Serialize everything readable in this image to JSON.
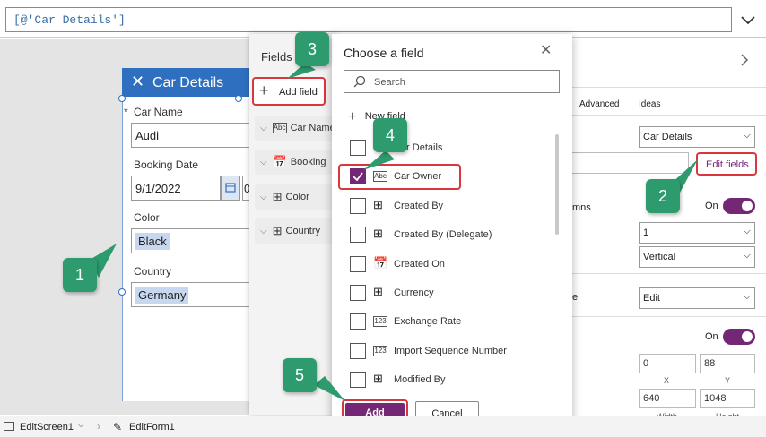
{
  "formula": {
    "value": "[@'Car Details']"
  },
  "form": {
    "title": "Car Details",
    "fields": [
      {
        "label": "Car Name",
        "required": "*",
        "value": "Audi"
      },
      {
        "label": "Booking Date",
        "value": "9/1/2022",
        "extra": "0"
      },
      {
        "label": "Color",
        "value": "Black"
      },
      {
        "label": "Country",
        "value": "Germany"
      }
    ]
  },
  "fields_pane": {
    "title": "Fields",
    "add_label": "Add field",
    "items": [
      {
        "label": "Car Name",
        "icon": "Abc"
      },
      {
        "label": "Booking",
        "icon": "calendar"
      },
      {
        "label": "Color",
        "icon": "grid"
      },
      {
        "label": "Country",
        "icon": "grid"
      }
    ]
  },
  "choose": {
    "title": "Choose a field",
    "search_placeholder": "Search",
    "new_field": "New field",
    "items": [
      {
        "label": "Car Details",
        "icon": "grid",
        "checked": false
      },
      {
        "label": "Car Owner",
        "icon": "Abc",
        "checked": true
      },
      {
        "label": "Created By",
        "icon": "grid",
        "checked": false
      },
      {
        "label": "Created By (Delegate)",
        "icon": "grid",
        "checked": false
      },
      {
        "label": "Created On",
        "icon": "calendar",
        "checked": false
      },
      {
        "label": "Currency",
        "icon": "grid",
        "checked": false
      },
      {
        "label": "Exchange Rate",
        "icon": "123",
        "checked": false
      },
      {
        "label": "Import Sequence Number",
        "icon": "123",
        "checked": false
      },
      {
        "label": "Modified By",
        "icon": "grid",
        "checked": false
      }
    ],
    "add_label": "Add",
    "cancel_label": "Cancel"
  },
  "right_pane": {
    "tabs": [
      "Advanced",
      "Ideas"
    ],
    "datasource": "Car Details",
    "edit_fields": "Edit fields",
    "columns_label": "mns",
    "toggle1_label": "On",
    "columns_value": "1",
    "layout_value": "Vertical",
    "mode_label": "e",
    "mode_value": "Edit",
    "toggle2_label": "On",
    "x": "0",
    "y": "88",
    "x_label": "X",
    "y_label": "Y",
    "width": "640",
    "height": "1048",
    "width_label": "Width",
    "height_label": "Height"
  },
  "bottom_bar": {
    "screen": "EditScreen1",
    "form": "EditForm1"
  },
  "callouts": [
    "1",
    "2",
    "3",
    "4",
    "5"
  ],
  "colors": {
    "accent": "#742774",
    "callout": "#2e9b6e",
    "highlight": "#d9363e",
    "header": "#2f6fbf"
  }
}
